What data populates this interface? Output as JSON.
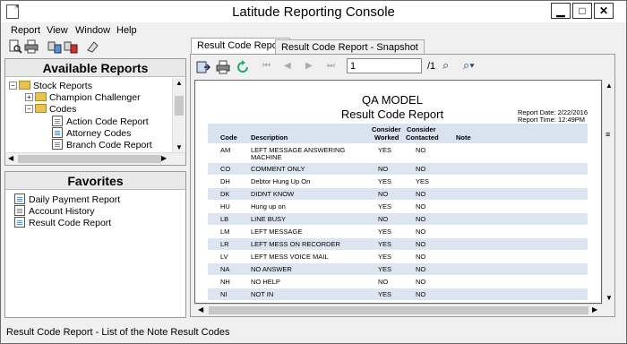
{
  "window": {
    "title": "Latitude Reporting Console"
  },
  "menu": [
    "Report",
    "View",
    "Window",
    "Help"
  ],
  "available_reports": {
    "header": "Available Reports",
    "tree": [
      "Stock Reports",
      "Champion Challenger",
      "Codes",
      "Action Code Report",
      "Attorney Codes",
      "Branch Code Report"
    ]
  },
  "favorites": {
    "header": "Favorites",
    "items": [
      "Daily Payment Report",
      "Account History",
      "Result Code Report"
    ]
  },
  "tabs": [
    "Result Code Report",
    "Result Code Report - Snapshot"
  ],
  "viewer": {
    "page": "1",
    "page_total": "/1"
  },
  "report": {
    "title1": "QA MODEL",
    "title2": "Result Code Report",
    "date_label": "Report Date:",
    "date": "2/22/2016",
    "time_label": "Report Time:",
    "time": "12:49PM",
    "columns": {
      "code": "Code",
      "desc": "Description",
      "worked1": "Consider",
      "worked2": "Worked",
      "contacted1": "Consider",
      "contacted2": "Contacted",
      "note": "Note"
    },
    "rows": [
      {
        "code": "AM",
        "desc1": "LEFT MESSAGE ANSWERING",
        "desc2": "MACHINE",
        "worked": "YES",
        "contacted": "NO"
      },
      {
        "code": "CO",
        "desc1": "COMMENT ONLY",
        "desc2": "",
        "worked": "NO",
        "contacted": "NO"
      },
      {
        "code": "DH",
        "desc1": "Debtor Hung Up On",
        "desc2": "",
        "worked": "YES",
        "contacted": "YES"
      },
      {
        "code": "DK",
        "desc1": "DIDNT KNOW",
        "desc2": "",
        "worked": "NO",
        "contacted": "NO"
      },
      {
        "code": "HU",
        "desc1": "Hung up on",
        "desc2": "",
        "worked": "YES",
        "contacted": "NO"
      },
      {
        "code": "LB",
        "desc1": "LINE BUSY",
        "desc2": "",
        "worked": "NO",
        "contacted": "NO"
      },
      {
        "code": "LM",
        "desc1": "LEFT MESSAGE",
        "desc2": "",
        "worked": "YES",
        "contacted": "NO"
      },
      {
        "code": "LR",
        "desc1": "LEFT MESS ON RECORDER",
        "desc2": "",
        "worked": "YES",
        "contacted": "NO"
      },
      {
        "code": "LV",
        "desc1": "LEFT MESS VOICE MAIL",
        "desc2": "",
        "worked": "YES",
        "contacted": "NO"
      },
      {
        "code": "NA",
        "desc1": "NO ANSWER",
        "desc2": "",
        "worked": "YES",
        "contacted": "NO"
      },
      {
        "code": "NH",
        "desc1": "NO HELP",
        "desc2": "",
        "worked": "NO",
        "contacted": "NO"
      },
      {
        "code": "NI",
        "desc1": "NOT IN",
        "desc2": "",
        "worked": "YES",
        "contacted": "NO"
      }
    ]
  },
  "status": "Result Code Report - List of the Note Result Codes"
}
